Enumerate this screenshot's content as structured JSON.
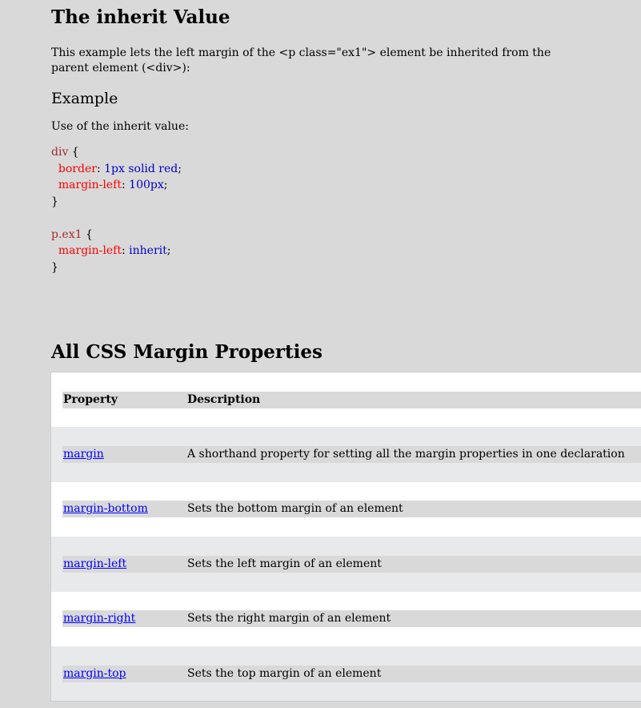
{
  "title": "The inherit Value",
  "intro": "This example lets the left margin of the <p class=\"ex1\"> element be inherited from the parent element (<div>):",
  "example_heading": "Example",
  "example_text": "Use of the inherit value:",
  "code": {
    "sel1": "div",
    "ob": " {",
    "p1": "border",
    "v1": "1px solid red",
    "p2": "margin-left",
    "v2": "100px",
    "cb": "}",
    "sel2": "p.ex1",
    "p3": "margin-left",
    "v3": "inherit"
  },
  "section_heading": "All CSS Margin Properties",
  "table": {
    "headers": [
      "Property",
      "Description"
    ],
    "rows": [
      {
        "property": "margin",
        "description": "A shorthand property for setting all the margin properties in one declaration"
      },
      {
        "property": "margin-bottom",
        "description": "Sets the bottom margin of an element"
      },
      {
        "property": "margin-left",
        "description": "Sets the left margin of an element"
      },
      {
        "property": "margin-right",
        "description": "Sets the right margin of an element"
      },
      {
        "property": "margin-top",
        "description": "Sets the top margin of an element"
      }
    ]
  }
}
